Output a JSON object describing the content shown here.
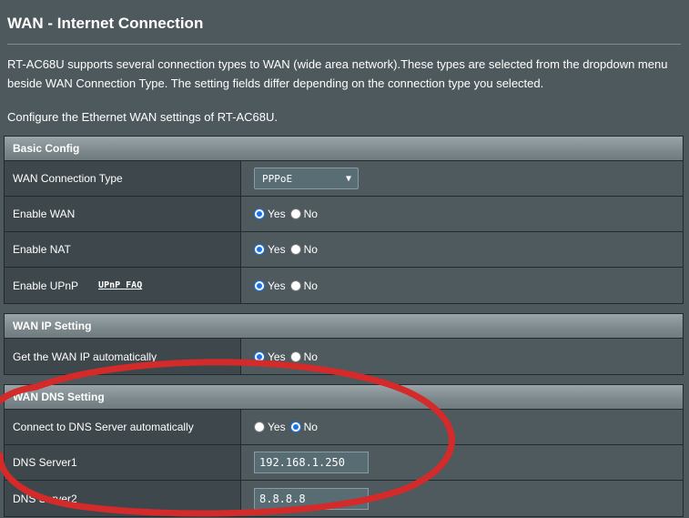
{
  "page": {
    "title": "WAN - Internet Connection",
    "description": "RT-AC68U supports several connection types to WAN (wide area network).These types are selected from the dropdown menu beside WAN Connection Type. The setting fields differ depending on the connection type you selected.",
    "subdescription": "Configure the Ethernet WAN settings of RT-AC68U."
  },
  "basic_config": {
    "header": "Basic Config",
    "wan_connection_type": {
      "label": "WAN Connection Type",
      "value": "PPPoE"
    },
    "enable_wan": {
      "label": "Enable WAN",
      "selected": "Yes"
    },
    "enable_nat": {
      "label": "Enable NAT",
      "selected": "Yes"
    },
    "enable_upnp": {
      "label": "Enable UPnP",
      "faq_link": "UPnP FAQ",
      "selected": "Yes"
    }
  },
  "wan_ip": {
    "header": "WAN IP Setting",
    "auto_ip": {
      "label": "Get the WAN IP automatically",
      "selected": "Yes"
    }
  },
  "wan_dns": {
    "header": "WAN DNS Setting",
    "auto_dns": {
      "label": "Connect to DNS Server automatically",
      "selected": "No"
    },
    "dns1": {
      "label": "DNS Server1",
      "value": "192.168.1.250"
    },
    "dns2": {
      "label": "DNS Server2",
      "value": "8.8.8.8"
    }
  },
  "radio": {
    "yes": "Yes",
    "no": "No"
  },
  "colors": {
    "background": "#4d595d",
    "annotation": "#d42a2a",
    "radio_checked": "#1a73e8"
  }
}
